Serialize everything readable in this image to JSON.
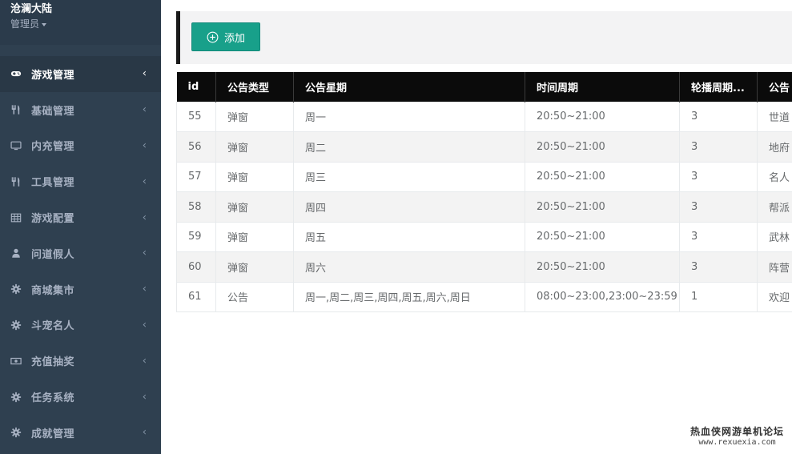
{
  "brand": {
    "title": "沧澜大陆",
    "role": "管理员"
  },
  "menu": [
    {
      "label": "游戏管理",
      "icon": "gamepad-icon",
      "active": true
    },
    {
      "label": "基础管理",
      "icon": "cutlery-icon",
      "active": false
    },
    {
      "label": "内充管理",
      "icon": "desktop-icon",
      "active": false
    },
    {
      "label": "工具管理",
      "icon": "cutlery-icon",
      "active": false
    },
    {
      "label": "游戏配置",
      "icon": "table-icon",
      "active": false
    },
    {
      "label": "问道假人",
      "icon": "user-icon",
      "active": false
    },
    {
      "label": "商城集市",
      "icon": "gear-icon",
      "active": false
    },
    {
      "label": "斗宠名人",
      "icon": "gear-icon",
      "active": false
    },
    {
      "label": "充值抽奖",
      "icon": "money-icon",
      "active": false
    },
    {
      "label": "任务系统",
      "icon": "gear-icon",
      "active": false
    },
    {
      "label": "成就管理",
      "icon": "gear-icon",
      "active": false
    }
  ],
  "menu_arrow": "‹",
  "toolbar": {
    "add_label": "添加"
  },
  "table": {
    "headers": [
      "id",
      "公告类型",
      "公告星期",
      "时间周期",
      "轮播周期...",
      "公告"
    ],
    "rows": [
      [
        "55",
        "弹窗",
        "周一",
        "20:50~21:00",
        "3",
        "世道"
      ],
      [
        "56",
        "弹窗",
        "周二",
        "20:50~21:00",
        "3",
        "地府"
      ],
      [
        "57",
        "弹窗",
        "周三",
        "20:50~21:00",
        "3",
        "名人"
      ],
      [
        "58",
        "弹窗",
        "周四",
        "20:50~21:00",
        "3",
        "帮派"
      ],
      [
        "59",
        "弹窗",
        "周五",
        "20:50~21:00",
        "3",
        "武林"
      ],
      [
        "60",
        "弹窗",
        "周六",
        "20:50~21:00",
        "3",
        "阵营"
      ],
      [
        "61",
        "公告",
        "周一,周二,周三,周四,周五,周六,周日",
        "08:00~23:00,23:00~23:59",
        "1",
        "欢迎"
      ]
    ]
  },
  "watermark": {
    "top": "热血侠网游单机论坛",
    "bottom": "www.rexuexia.com"
  },
  "colors": {
    "sidebar": "#2f4050",
    "accent": "#18a08a",
    "header": "#0b0b0b"
  }
}
